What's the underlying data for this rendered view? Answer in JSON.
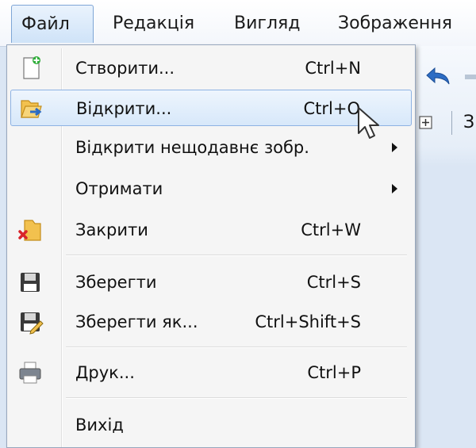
{
  "menubar": {
    "items": [
      {
        "label": "Файл",
        "active": true
      },
      {
        "label": "Редакція"
      },
      {
        "label": "Вигляд"
      },
      {
        "label": "Зображення"
      }
    ]
  },
  "toolbar": {
    "partial_text": "З"
  },
  "file_menu": {
    "items": [
      {
        "label": "Створити...",
        "shortcut": "Ctrl+N",
        "icon": "new-document-icon"
      },
      {
        "label": "Відкрити...",
        "shortcut": "Ctrl+O",
        "icon": "open-folder-icon",
        "highlighted": true
      },
      {
        "label": "Відкрити нещодавнє зобр.",
        "submenu": true
      },
      {
        "label": "Отримати",
        "submenu": true
      },
      {
        "label": "Закрити",
        "shortcut": "Ctrl+W",
        "icon": "close-folder-icon"
      },
      {
        "label": "Зберегти",
        "shortcut": "Ctrl+S",
        "icon": "save-icon"
      },
      {
        "label": "Зберегти як...",
        "shortcut": "Ctrl+Shift+S",
        "icon": "save-as-icon"
      },
      {
        "label": "Друк...",
        "shortcut": "Ctrl+P",
        "icon": "printer-icon"
      },
      {
        "label": "Вихід"
      }
    ]
  },
  "colors": {
    "highlight_border": "#8db2e3",
    "menu_background": "#f5f5f5",
    "accent": "#2c6cc4"
  }
}
